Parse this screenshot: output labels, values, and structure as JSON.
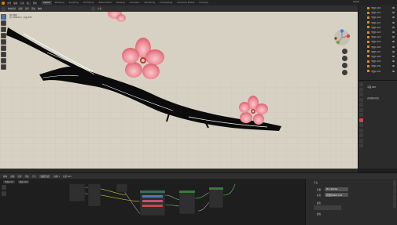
{
  "topbar": {
    "menu": [
      "文件",
      "编辑",
      "渲染",
      "窗口",
      "帮助"
    ],
    "tabs": [
      {
        "label": "Layout",
        "active": true
      },
      {
        "label": "Modeling",
        "active": false
      },
      {
        "label": "Sculpting",
        "active": false
      },
      {
        "label": "UV Editing",
        "active": false
      },
      {
        "label": "Texture Paint",
        "active": false
      },
      {
        "label": "Shading",
        "active": false
      },
      {
        "label": "Animation",
        "active": false
      },
      {
        "label": "Rendering",
        "active": false
      },
      {
        "label": "Compositing",
        "active": false
      },
      {
        "label": "Geometry Nodes",
        "active": false
      },
      {
        "label": "Scripting",
        "active": false
      }
    ],
    "scene": "Scene"
  },
  "viewport_header": {
    "mode": "物体模式",
    "view": "视图",
    "select": "选择",
    "add": "添加",
    "object": "物体",
    "transform": "全局"
  },
  "viewport_info": {
    "line1": "用户透视",
    "line2": "(1) Collection | 平面.250"
  },
  "outliner": {
    "items": [
      "平面1.018",
      "平面1.019",
      "平面1.020",
      "平面1.021",
      "平面1.022",
      "平面1.023",
      "平面1.024",
      "平面1.025",
      "平面1.026",
      "平面1.027",
      "平面1.028",
      "平面1.029",
      "平面1.030",
      "平面1.031"
    ]
  },
  "properties": {
    "object_name": "平面.250",
    "section": "表面细分修改"
  },
  "node_header": {
    "editor": "物体",
    "view": "视图",
    "select": "选择",
    "add": "添加",
    "node": "节点",
    "use_nodes_label": "使用节点",
    "slot": "插槽 1",
    "material": "材质.003"
  },
  "node_subheader": {
    "object": "平面.250",
    "material": "材质.003"
  },
  "npanel": {
    "title": "节点",
    "name_label": "名称",
    "name_value": "Mix Shader",
    "label_label": "标签",
    "node_value": "原理化BSDF.204",
    "color_label": "颜色",
    "props_label": "属性"
  },
  "colors": {
    "accent": "#4772b3",
    "viewport_bg": "#d7d1c3",
    "blossom": "#f08a95",
    "branch": "#0a0a0a"
  }
}
